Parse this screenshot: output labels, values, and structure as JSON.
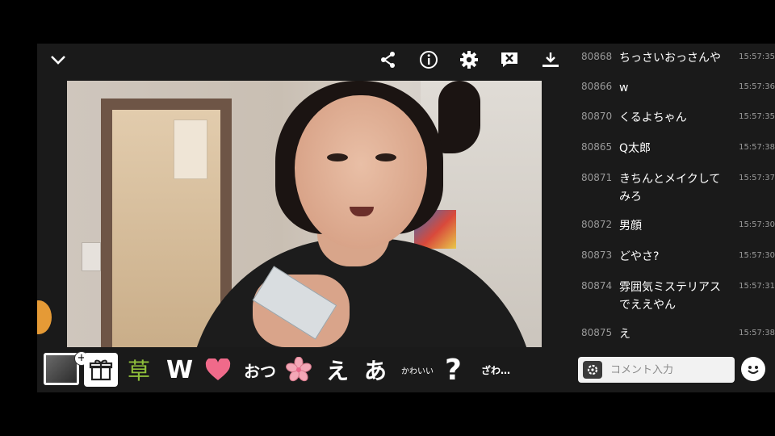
{
  "topbar": {
    "icons": [
      "chevron-down-icon",
      "share-icon",
      "info-icon",
      "settings-icon",
      "comment-close-icon",
      "download-icon"
    ]
  },
  "stamps": [
    {
      "name": "stamp-kusa",
      "label": "草"
    },
    {
      "name": "stamp-w",
      "label": "W"
    },
    {
      "name": "stamp-heart",
      "label": ""
    },
    {
      "name": "stamp-otsu",
      "label": "おつ"
    },
    {
      "name": "stamp-sakura",
      "label": ""
    },
    {
      "name": "stamp-e",
      "label": "え"
    },
    {
      "name": "stamp-a",
      "label": "あ"
    },
    {
      "name": "stamp-kawaii",
      "label": "かわいい"
    },
    {
      "name": "stamp-question",
      "label": "?"
    },
    {
      "name": "stamp-zawa",
      "label": "ざわ…"
    }
  ],
  "comments": [
    {
      "num": "80868",
      "text": "ちっさいおっさんや",
      "time": "15:57:35"
    },
    {
      "num": "80866",
      "text": "w",
      "time": "15:57:36"
    },
    {
      "num": "80870",
      "text": "くるよちゃん",
      "time": "15:57:35"
    },
    {
      "num": "80865",
      "text": "Q太郎",
      "time": "15:57:38"
    },
    {
      "num": "80871",
      "text": "きちんとメイクしてみろ",
      "time": "15:57:37"
    },
    {
      "num": "80872",
      "text": "男顔",
      "time": "15:57:30"
    },
    {
      "num": "80873",
      "text": "どやさ?",
      "time": "15:57:30"
    },
    {
      "num": "80874",
      "text": "雰囲気ミステリアスでええやん",
      "time": "15:57:31"
    },
    {
      "num": "80875",
      "text": "え",
      "time": "15:57:38"
    }
  ],
  "comment_input": {
    "placeholder": "コメント入力",
    "value": ""
  },
  "colors": {
    "background": "#1a1a1a",
    "accent_kusa": "#8fbf3a",
    "heart": "#f06a8a",
    "sakura": "#f3a7b6"
  }
}
